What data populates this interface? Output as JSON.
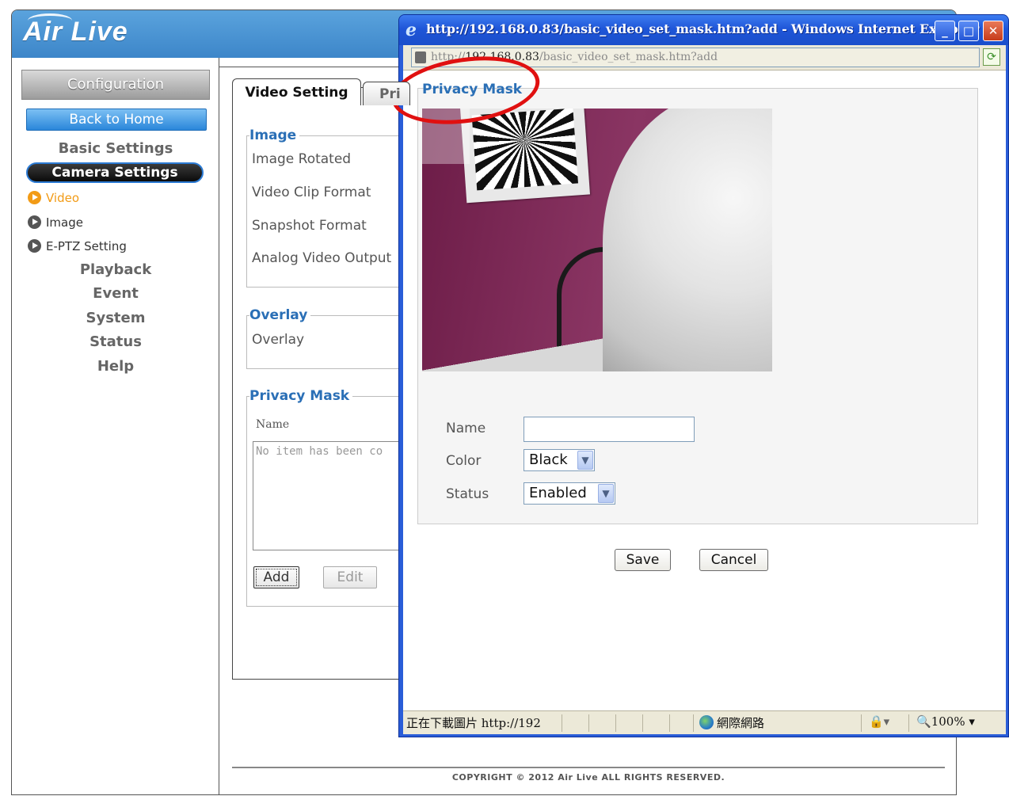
{
  "brand": {
    "logo_text": "Air Live"
  },
  "sidebar": {
    "config_tab": "Configuration",
    "back_home": "Back to Home",
    "basic_settings": "Basic Settings",
    "camera_settings": "Camera Settings",
    "sub_items": [
      {
        "label": "Video",
        "active": true
      },
      {
        "label": "Image",
        "active": false
      },
      {
        "label": "E-PTZ Setting",
        "active": false
      }
    ],
    "groups": [
      "Playback",
      "Event",
      "System",
      "Status",
      "Help"
    ]
  },
  "tabs": {
    "video_setting": "Video Setting",
    "privacy_partial": "Pri"
  },
  "image_section": {
    "legend": "Image",
    "fields": [
      "Image Rotated",
      "Video Clip Format",
      "Snapshot Format",
      "Analog Video Output"
    ]
  },
  "overlay_section": {
    "legend": "Overlay",
    "fields": [
      "Overlay"
    ]
  },
  "privacy_section": {
    "legend": "Privacy Mask",
    "name_header": "Name",
    "list_placeholder": "No item has been co",
    "add_label": "Add",
    "edit_label": "Edit"
  },
  "footer": {
    "copyright": "COPYRIGHT © 2012 Air Live ALL RIGHTS RESERVED."
  },
  "popup": {
    "title": "http://192.168.0.83/basic_video_set_mask.htm?add - Windows Internet Explorer",
    "address_prefix": "http://",
    "address_host": "192.168.0.83",
    "address_path": "/basic_video_set_mask.htm?add",
    "section_title": "Privacy Mask",
    "form": {
      "name_label": "Name",
      "name_value": "",
      "color_label": "Color",
      "color_value": "Black",
      "status_label": "Status",
      "status_value": "Enabled"
    },
    "save_label": "Save",
    "cancel_label": "Cancel",
    "statusbar": {
      "text": "正在下載圖片 http://192",
      "zone": "網際網路",
      "zoom": "100%"
    }
  },
  "colors": {
    "header_blue": "#3d86c9",
    "accent_orange": "#f29b16",
    "legend_blue": "#2a6fb6",
    "ie_blue": "#2a5dd8",
    "highlight_red": "#e01010"
  }
}
